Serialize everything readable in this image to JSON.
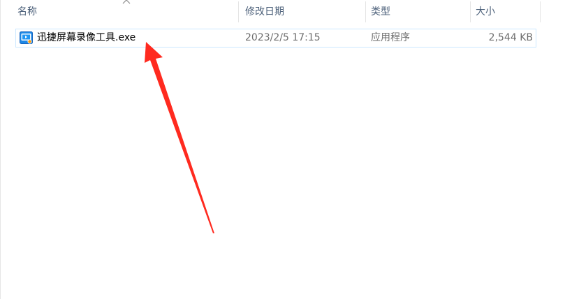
{
  "columns": {
    "name": "名称",
    "modified": "修改日期",
    "type": "类型",
    "size": "大小"
  },
  "files": [
    {
      "name": "迅捷屏幕录像工具.exe",
      "modified": "2023/2/5 17:15",
      "type": "应用程序",
      "size": "2,544 KB",
      "icon": "app-icon"
    }
  ],
  "annotation": {
    "arrow_color": "#ff2a1f"
  }
}
